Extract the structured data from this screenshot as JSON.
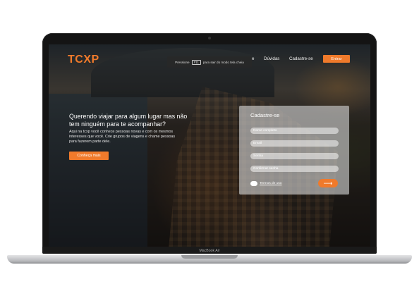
{
  "laptop": {
    "brand": "MacBook Air"
  },
  "app": {
    "logo": "TCXP",
    "fullscreen_banner": {
      "prefix": "Pressione",
      "key": "F11",
      "suffix": "para sair do modo tela cheia"
    },
    "nav": {
      "partial_item": "e",
      "duvidas": "Dúvidas",
      "cadastre": "Cadastre-se",
      "entrar": "Entrar"
    },
    "hero": {
      "title": "Querendo viajar para algum lugar mas não tem ninguém para te acompanhar?",
      "text": "Aqui na tcxp você conhece pessoas novas e com os mesmos interesses que você. Crie grupos de viagens e chame pessoas para fazerem parte dele.",
      "cta": "Conheça mais"
    },
    "signup": {
      "title": "Cadastre-se",
      "fields": {
        "nome": "Nome completo",
        "email": "Email",
        "senha": "Senha",
        "confirmar": "Confirmar senha"
      },
      "terms": "Termos de uso",
      "submit_icon": "arrow-right-icon"
    }
  },
  "colors": {
    "accent": "#f07a2b"
  }
}
